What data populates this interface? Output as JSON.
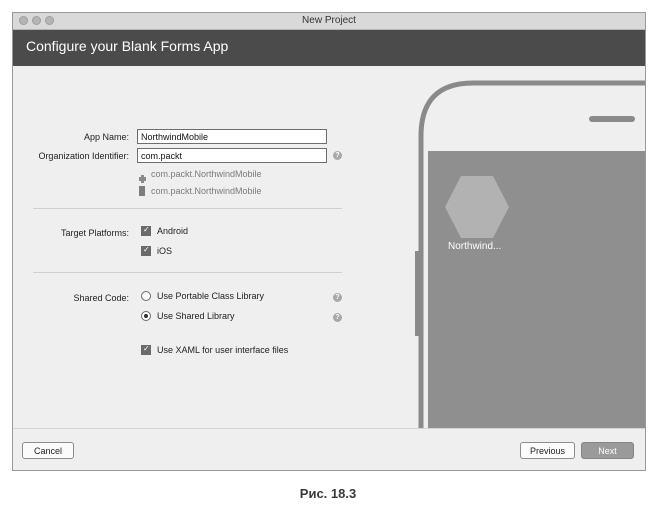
{
  "window": {
    "title": "New Project"
  },
  "header": {
    "title": "Configure your Blank Forms App"
  },
  "form": {
    "app_name_label": "App Name:",
    "app_name_value": "NorthwindMobile",
    "org_id_label": "Organization Identifier:",
    "org_id_value": "com.packt",
    "android_id": "com.packt.NorthwindMobile",
    "ios_id": "com.packt.NorthwindMobile",
    "target_platforms_label": "Target Platforms:",
    "android_label": "Android",
    "ios_label": "iOS",
    "shared_code_label": "Shared Code:",
    "pcl_label": "Use Portable Class Library",
    "shared_lib_label": "Use Shared Library",
    "xaml_label": "Use XAML for user interface files",
    "android_checked": true,
    "ios_checked": true,
    "shared_code_selected": "Use Shared Library",
    "xaml_checked": true,
    "help_glyph": "?"
  },
  "preview": {
    "app_label": "Northwind..."
  },
  "footer": {
    "cancel_label": "Cancel",
    "previous_label": "Previous",
    "next_label": "Next"
  },
  "caption": "Рис. 18.3",
  "icons": [
    "android-icon",
    "apple-icon",
    "help-icon",
    "app-hexagon-icon"
  ],
  "colors": {
    "header_bg": "#4b4b4b",
    "preview_bg": "#8f8f8f",
    "next_button": "#9a9a9a"
  }
}
